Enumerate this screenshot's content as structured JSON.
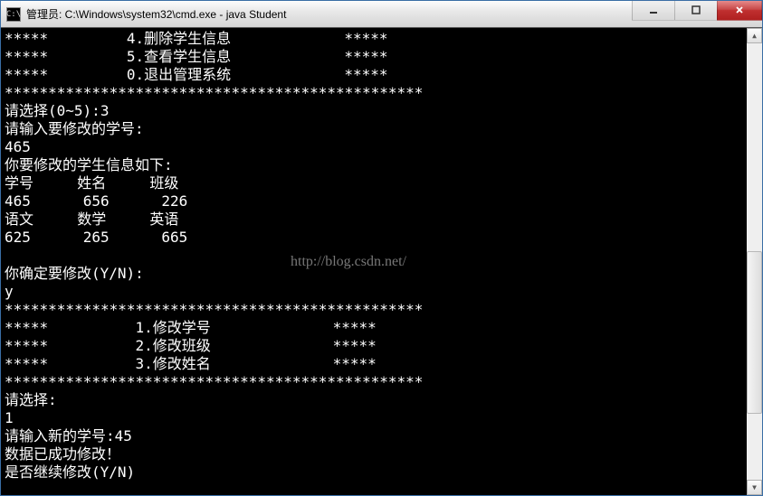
{
  "window": {
    "title": "管理员: C:\\Windows\\system32\\cmd.exe - java  Student",
    "icon_label": "C:\\"
  },
  "menu_top": {
    "item4": "4.删除学生信息",
    "item5": "5.查看学生信息",
    "item0": "0.退出管理系统"
  },
  "prompts": {
    "select_0_5": "请选择(0~5):",
    "select_input": "3",
    "enter_id_to_modify": "请输入要修改的学号:",
    "entered_id": "465",
    "info_header": "你要修改的学生信息如下:",
    "col_id": "学号",
    "col_name": "姓名",
    "col_class": "班级",
    "row1_id": "465",
    "row1_name": "656",
    "row1_class": "226",
    "col_chinese": "语文",
    "col_math": "数学",
    "col_english": "英语",
    "row2_chinese": "625",
    "row2_math": "265",
    "row2_english": "665",
    "confirm_modify": "你确定要修改(Y/N):",
    "confirm_input": "y",
    "sub1": "1.修改学号",
    "sub2": "2.修改班级",
    "sub3": "3.修改姓名",
    "please_select": "请选择:",
    "select2_input": "1",
    "enter_new_id": "请输入新的学号:",
    "new_id": "45",
    "success": "数据已成功修改！",
    "continue_modify": "是否继续修改(Y/N)"
  },
  "deco": {
    "stars5": "*****",
    "stars_long": "************************************************"
  },
  "watermark": "http://blog.csdn.net/"
}
